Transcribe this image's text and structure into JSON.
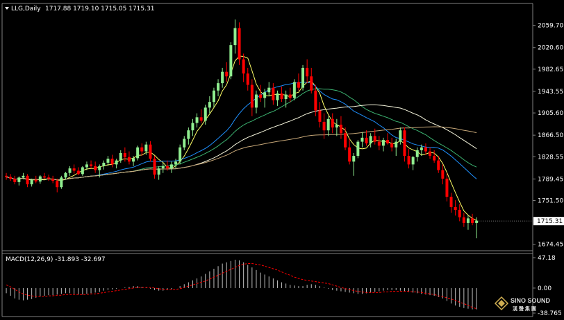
{
  "header": {
    "symbol": "LLG,Daily",
    "ohlc": "1717.88 1719.10 1715.05 1715.31"
  },
  "price_axis": {
    "ticks": [
      "2059.70",
      "2020.60",
      "1982.65",
      "1943.55",
      "1905.60",
      "1866.50",
      "1828.55",
      "1789.45",
      "1751.50",
      "1715.31",
      "1674.45"
    ],
    "current_price_label": "1715.31"
  },
  "macd_panel": {
    "label": "MACD(12,26,9) -31.893 -32.697",
    "ticks": [
      "47.18",
      "0.00",
      "-38.765"
    ]
  },
  "logo": {
    "line1": "SINO SOUND",
    "line2": "漢 聲 集 團"
  },
  "colors": {
    "background": "#000000",
    "grid_border": "#808080",
    "bull_candle": "#90ee90",
    "bear_candle": "#ff0000",
    "ma_fast": "#ffff66",
    "ma_mid1": "#1e90ff",
    "ma_mid2": "#3cb371",
    "ma_long1": "#f5f5dc",
    "ma_long2": "#c8a878",
    "macd_hist": "#c0c0c0",
    "macd_signal": "#ff0000"
  },
  "chart_data": {
    "type": "candlestick",
    "title": "LLG,Daily",
    "ylim": [
      1668,
      2080
    ],
    "candles": [
      [
        1795,
        1800,
        1788,
        1793
      ],
      [
        1793,
        1798,
        1786,
        1790
      ],
      [
        1790,
        1795,
        1780,
        1784
      ],
      [
        1784,
        1794,
        1778,
        1792
      ],
      [
        1792,
        1800,
        1789,
        1795
      ],
      [
        1795,
        1798,
        1775,
        1780
      ],
      [
        1780,
        1790,
        1776,
        1788
      ],
      [
        1788,
        1795,
        1782,
        1785
      ],
      [
        1785,
        1796,
        1781,
        1794
      ],
      [
        1794,
        1800,
        1790,
        1792
      ],
      [
        1792,
        1797,
        1786,
        1790
      ],
      [
        1790,
        1795,
        1782,
        1786
      ],
      [
        1786,
        1790,
        1766,
        1775
      ],
      [
        1775,
        1795,
        1772,
        1792
      ],
      [
        1792,
        1802,
        1788,
        1800
      ],
      [
        1800,
        1812,
        1795,
        1808
      ],
      [
        1808,
        1815,
        1799,
        1804
      ],
      [
        1804,
        1810,
        1796,
        1798
      ],
      [
        1798,
        1812,
        1795,
        1810
      ],
      [
        1810,
        1820,
        1805,
        1815
      ],
      [
        1815,
        1822,
        1808,
        1812
      ],
      [
        1812,
        1820,
        1800,
        1805
      ],
      [
        1805,
        1815,
        1792,
        1812
      ],
      [
        1812,
        1822,
        1806,
        1818
      ],
      [
        1818,
        1830,
        1812,
        1825
      ],
      [
        1825,
        1832,
        1810,
        1815
      ],
      [
        1815,
        1825,
        1808,
        1822
      ],
      [
        1822,
        1840,
        1818,
        1835
      ],
      [
        1835,
        1845,
        1820,
        1828
      ],
      [
        1828,
        1838,
        1815,
        1820
      ],
      [
        1820,
        1830,
        1812,
        1826
      ],
      [
        1826,
        1848,
        1822,
        1845
      ],
      [
        1845,
        1852,
        1830,
        1838
      ],
      [
        1838,
        1855,
        1832,
        1850
      ],
      [
        1850,
        1856,
        1820,
        1825
      ],
      [
        1825,
        1830,
        1790,
        1797
      ],
      [
        1797,
        1812,
        1788,
        1808
      ],
      [
        1808,
        1818,
        1800,
        1812
      ],
      [
        1812,
        1822,
        1804,
        1808
      ],
      [
        1808,
        1820,
        1800,
        1815
      ],
      [
        1815,
        1825,
        1808,
        1820
      ],
      [
        1820,
        1850,
        1815,
        1845
      ],
      [
        1845,
        1865,
        1840,
        1860
      ],
      [
        1860,
        1880,
        1850,
        1875
      ],
      [
        1875,
        1895,
        1865,
        1888
      ],
      [
        1888,
        1905,
        1880,
        1898
      ],
      [
        1898,
        1912,
        1888,
        1892
      ],
      [
        1892,
        1920,
        1885,
        1915
      ],
      [
        1915,
        1935,
        1905,
        1925
      ],
      [
        1925,
        1950,
        1915,
        1945
      ],
      [
        1945,
        1965,
        1935,
        1958
      ],
      [
        1958,
        1985,
        1950,
        1978
      ],
      [
        1978,
        1995,
        1960,
        1970
      ],
      [
        1970,
        2030,
        1965,
        2025
      ],
      [
        2025,
        2070,
        2010,
        2055
      ],
      [
        2055,
        2065,
        1990,
        2000
      ],
      [
        2000,
        2010,
        1960,
        1975
      ],
      [
        1975,
        1985,
        1945,
        1955
      ],
      [
        1955,
        1965,
        1900,
        1915
      ],
      [
        1915,
        1945,
        1905,
        1938
      ],
      [
        1938,
        1955,
        1925,
        1932
      ],
      [
        1932,
        1948,
        1915,
        1942
      ],
      [
        1942,
        1960,
        1935,
        1950
      ],
      [
        1950,
        1958,
        1920,
        1928
      ],
      [
        1928,
        1945,
        1918,
        1940
      ],
      [
        1940,
        1952,
        1925,
        1930
      ],
      [
        1930,
        1945,
        1915,
        1938
      ],
      [
        1938,
        1950,
        1925,
        1932
      ],
      [
        1932,
        1965,
        1928,
        1960
      ],
      [
        1960,
        1975,
        1945,
        1950
      ],
      [
        1950,
        1990,
        1945,
        1985
      ],
      [
        1985,
        2000,
        1958,
        1970
      ],
      [
        1970,
        1985,
        1940,
        1945
      ],
      [
        1945,
        1955,
        1900,
        1910
      ],
      [
        1910,
        1925,
        1880,
        1890
      ],
      [
        1890,
        1905,
        1860,
        1875
      ],
      [
        1875,
        1900,
        1865,
        1895
      ],
      [
        1895,
        1905,
        1870,
        1880
      ],
      [
        1880,
        1895,
        1865,
        1885
      ],
      [
        1885,
        1900,
        1860,
        1870
      ],
      [
        1870,
        1880,
        1840,
        1845
      ],
      [
        1845,
        1860,
        1815,
        1820
      ],
      [
        1820,
        1835,
        1795,
        1830
      ],
      [
        1830,
        1858,
        1826,
        1855
      ],
      [
        1855,
        1872,
        1845,
        1862
      ],
      [
        1862,
        1875,
        1848,
        1852
      ],
      [
        1852,
        1870,
        1845,
        1865
      ],
      [
        1865,
        1878,
        1850,
        1855
      ],
      [
        1855,
        1865,
        1840,
        1848
      ],
      [
        1848,
        1862,
        1838,
        1858
      ],
      [
        1858,
        1870,
        1850,
        1852
      ],
      [
        1852,
        1862,
        1838,
        1845
      ],
      [
        1845,
        1860,
        1830,
        1855
      ],
      [
        1855,
        1880,
        1850,
        1875
      ],
      [
        1875,
        1880,
        1820,
        1830
      ],
      [
        1830,
        1842,
        1808,
        1815
      ],
      [
        1815,
        1830,
        1805,
        1828
      ],
      [
        1828,
        1845,
        1820,
        1840
      ],
      [
        1840,
        1850,
        1830,
        1845
      ],
      [
        1845,
        1852,
        1832,
        1838
      ],
      [
        1838,
        1845,
        1825,
        1830
      ],
      [
        1830,
        1840,
        1818,
        1822
      ],
      [
        1822,
        1830,
        1800,
        1805
      ],
      [
        1805,
        1815,
        1780,
        1790
      ],
      [
        1790,
        1800,
        1750,
        1758
      ],
      [
        1758,
        1765,
        1730,
        1740
      ],
      [
        1740,
        1752,
        1725,
        1735
      ],
      [
        1735,
        1745,
        1715,
        1722
      ],
      [
        1722,
        1730,
        1705,
        1712
      ],
      [
        1712,
        1725,
        1700,
        1720
      ],
      [
        1720,
        1728,
        1708,
        1712
      ],
      [
        1712,
        1722,
        1685,
        1716
      ]
    ],
    "macd": {
      "ylim": [
        -38.765,
        47.18
      ],
      "histogram": [
        -8,
        -12,
        -16,
        -18,
        -19,
        -18,
        -17,
        -15,
        -13,
        -12,
        -11,
        -11,
        -10,
        -9,
        -8,
        -8,
        -9,
        -10,
        -10,
        -9,
        -8,
        -7,
        -6,
        -4,
        -3,
        -2,
        -1,
        0,
        1,
        2,
        3,
        3,
        2,
        1,
        -1,
        -3,
        -4,
        -4,
        -3,
        -2,
        0,
        3,
        6,
        9,
        12,
        15,
        18,
        22,
        26,
        30,
        34,
        38,
        40,
        42,
        44,
        43,
        40,
        36,
        32,
        28,
        24,
        21,
        18,
        15,
        12,
        9,
        7,
        5,
        4,
        3,
        3,
        5,
        6,
        5,
        3,
        1,
        -1,
        -3,
        -4,
        -5,
        -6,
        -7,
        -8,
        -9,
        -9,
        -8,
        -7,
        -6,
        -5,
        -4,
        -3,
        -3,
        -3,
        -4,
        -5,
        -6,
        -7,
        -8,
        -9,
        -10,
        -11,
        -12,
        -14,
        -16,
        -20,
        -24,
        -27,
        -29,
        -31,
        -32,
        -33,
        -33
      ],
      "signal": [
        5,
        2,
        -2,
        -6,
        -9,
        -11,
        -12,
        -13,
        -13,
        -13,
        -12,
        -12,
        -11,
        -11,
        -10,
        -10,
        -10,
        -10,
        -10,
        -10,
        -9,
        -9,
        -8,
        -7,
        -6,
        -5,
        -4,
        -3,
        -2,
        -1,
        0,
        1,
        1,
        1,
        1,
        0,
        -1,
        -2,
        -2,
        -2,
        -2,
        -1,
        1,
        3,
        5,
        7,
        9,
        11,
        14,
        17,
        20,
        23,
        26,
        29,
        32,
        35,
        37,
        38,
        38,
        37,
        36,
        34,
        32,
        30,
        28,
        25,
        22,
        20,
        17,
        15,
        13,
        12,
        11,
        10,
        9,
        8,
        7,
        5,
        3,
        1,
        -1,
        -2,
        -4,
        -5,
        -6,
        -7,
        -7,
        -7,
        -7,
        -6,
        -6,
        -5,
        -5,
        -5,
        -5,
        -5,
        -6,
        -6,
        -7,
        -8,
        -9,
        -10,
        -12,
        -13,
        -15,
        -17,
        -19,
        -22,
        -24,
        -27,
        -30,
        -32
      ]
    }
  }
}
